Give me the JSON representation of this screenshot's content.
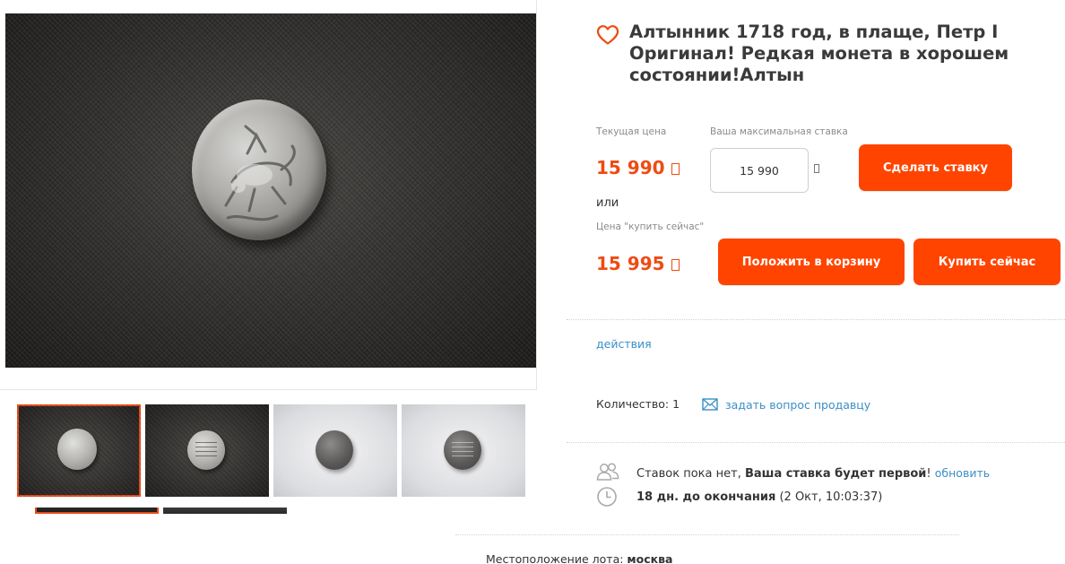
{
  "lot": {
    "title": "Алтынник 1718 год, в плаще, Петр I Оригинал! Редкая монета в хорошем состоянии!Алтын"
  },
  "pricing": {
    "current_label": "Текущая цена",
    "current_price": "15 990",
    "max_bid_label": "Ваша максимальная ставка",
    "max_bid_value": "15 990",
    "bid_button": "Сделать ставку",
    "or_text": "или",
    "buy_now_label": "Цена \"купить сейчас\"",
    "buy_now_price": "15 995",
    "cart_button": "Положить в корзину",
    "buy_button": "Купить сейчас",
    "accent_color": "#ff4400",
    "price_color": "#ee4b14"
  },
  "actions": {
    "link": "действия"
  },
  "details": {
    "quantity_label": "Количество:",
    "quantity_value": "1",
    "ask_seller": "задать вопрос продавцу"
  },
  "bids": {
    "none_text": "Ставок пока нет,",
    "first_bid_text": "Ваша ставка будет первой",
    "excl": "!",
    "refresh": "обновить",
    "time_left": "18 дн. до окончания",
    "end_time": "(2 Окт, 10:03:37)"
  },
  "location": {
    "label": "Местоположение лота:",
    "value": "москва"
  },
  "gallery": {
    "thumbnails": [
      {
        "name": "coin-obverse-dark",
        "background": "dark"
      },
      {
        "name": "coin-reverse-dark",
        "background": "dark"
      },
      {
        "name": "coin-obverse-light",
        "background": "light"
      },
      {
        "name": "coin-reverse-light",
        "background": "light"
      }
    ]
  },
  "icons": {
    "favorite": "heart-outline-icon",
    "mail": "envelope-icon",
    "bidders": "users-icon",
    "timer": "clock-icon",
    "currency": "ruble-icon"
  }
}
